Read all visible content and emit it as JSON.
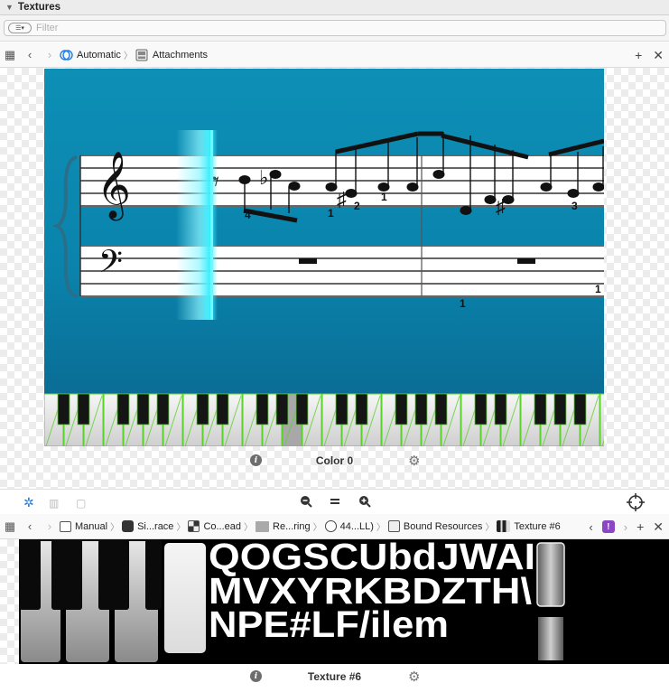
{
  "section": {
    "title": "Textures"
  },
  "filter": {
    "placeholder": "Filter"
  },
  "top_jumpbar": {
    "crumbs": [
      {
        "label": "Automatic",
        "icon": "automatic-circles-icon"
      },
      {
        "label": "Attachments",
        "icon": "attachments-icon"
      }
    ]
  },
  "preview_top": {
    "caption": "Color 0",
    "piece": {
      "fingerings": [
        "4",
        "1",
        "2",
        "1",
        "1",
        "3",
        "1"
      ],
      "accidentals": [
        "♭",
        "♯",
        "♯"
      ]
    }
  },
  "mid_toolbar": {
    "left_icons": [
      "debug-navigator-icon",
      "memory-icon",
      "frame-icon"
    ],
    "center_icons": [
      "zoom-out-icon",
      "zoom-reset-icon",
      "zoom-in-icon"
    ],
    "right_icon": "target-icon"
  },
  "bottom_jumpbar": {
    "crumbs": [
      {
        "label": "Manual",
        "icon": "panel-icon"
      },
      {
        "label": "Si...race",
        "icon": "app-icon"
      },
      {
        "label": "Co...ead",
        "icon": "checker-icon"
      },
      {
        "label": "Re...ring",
        "icon": "folder-icon"
      },
      {
        "label": "44...LL)",
        "icon": "gauge-icon"
      },
      {
        "label": "Bound Resources",
        "icon": "resources-icon"
      },
      {
        "label": "Texture #6",
        "icon": "texture-thumb-icon"
      }
    ],
    "badge": "!"
  },
  "preview_bottom": {
    "caption": "Texture #6",
    "glyph_lines": [
      "QOGSCUbdJWAI",
      "MVXYRKBDZTH\\",
      "NPE#LF/ilem"
    ]
  },
  "colors": {
    "accent": "#1e7de6",
    "staff_bg_top": "#0f8fb8",
    "staff_bg_bottom": "#0a7aa6",
    "playhead": "#3cf0ff",
    "key_outline": "#5bd12c",
    "key_highlight": "#9a5fb8"
  }
}
